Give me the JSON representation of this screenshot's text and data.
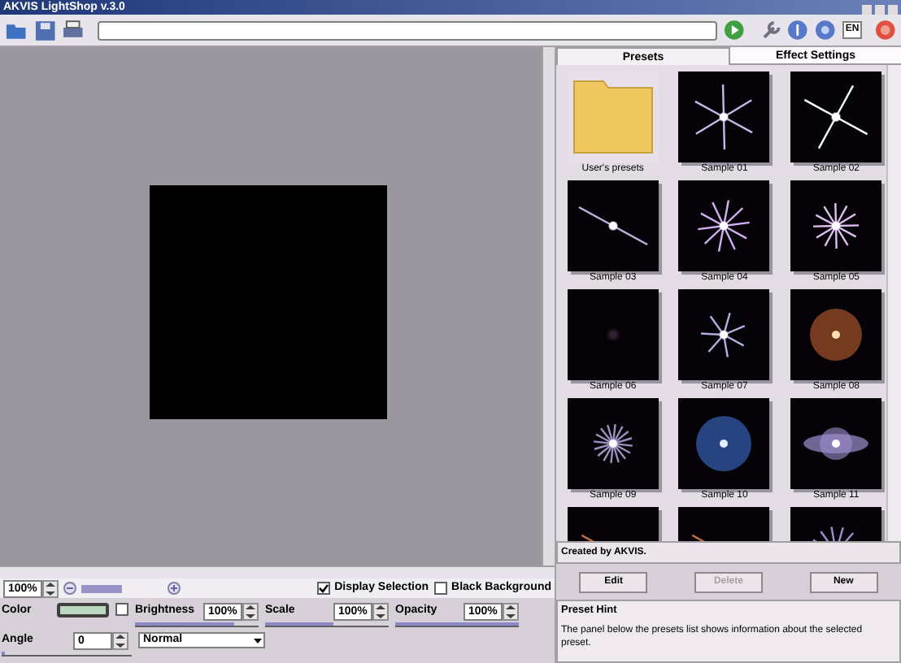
{
  "window": {
    "title": "AKVIS LightShop v.3.0"
  },
  "toolbar": {
    "language": "EN"
  },
  "tabs": [
    {
      "label": "Presets",
      "selected": true
    },
    {
      "label": "Effect Settings",
      "selected": false
    }
  ],
  "presets": [
    {
      "label": "User's presets",
      "kind": "folder"
    },
    {
      "label": "Sample 01",
      "kind": "picture"
    },
    {
      "label": "Sample 02",
      "kind": "picture"
    },
    {
      "label": "Sample 03",
      "kind": "picture"
    },
    {
      "label": "Sample 04",
      "kind": "picture"
    },
    {
      "label": "Sample 05",
      "kind": "picture"
    },
    {
      "label": "Sample 06",
      "kind": "picture"
    },
    {
      "label": "Sample 07",
      "kind": "picture"
    },
    {
      "label": "Sample 08",
      "kind": "picture"
    },
    {
      "label": "Sample 09",
      "kind": "picture"
    },
    {
      "label": "Sample 10",
      "kind": "picture"
    },
    {
      "label": "Sample 11",
      "kind": "picture"
    },
    {
      "kind": "picture"
    },
    {
      "kind": "picture"
    },
    {
      "kind": "picture"
    }
  ],
  "created_by": "Created by AKVIS.",
  "preset_buttons": [
    {
      "label": "Edit",
      "disabled": false
    },
    {
      "label": "Delete",
      "disabled": true
    },
    {
      "label": "New",
      "disabled": false
    }
  ],
  "hint": {
    "title": "Preset Hint",
    "text": "The panel below the presets list shows information about the selected preset."
  },
  "view": {
    "zoom": "100%",
    "zoom_slider": {
      "level": 0.5
    },
    "display_selection": {
      "label": "Display Selection",
      "checked": true
    },
    "black_background": {
      "label": "Black Background",
      "checked": false
    }
  },
  "color": {
    "label": "Color",
    "color": "#bcd8c0",
    "checked": false
  },
  "params": [
    {
      "label": "Brightness",
      "value": "100%",
      "level": 0.8
    },
    {
      "label": "Scale",
      "value": "100%",
      "level": 0.55
    },
    {
      "label": "Opacity",
      "value": "100%",
      "level": 1
    }
  ],
  "angle": {
    "label": "Angle",
    "value": "0",
    "level": 0.02
  },
  "blend_mode": "Normal"
}
